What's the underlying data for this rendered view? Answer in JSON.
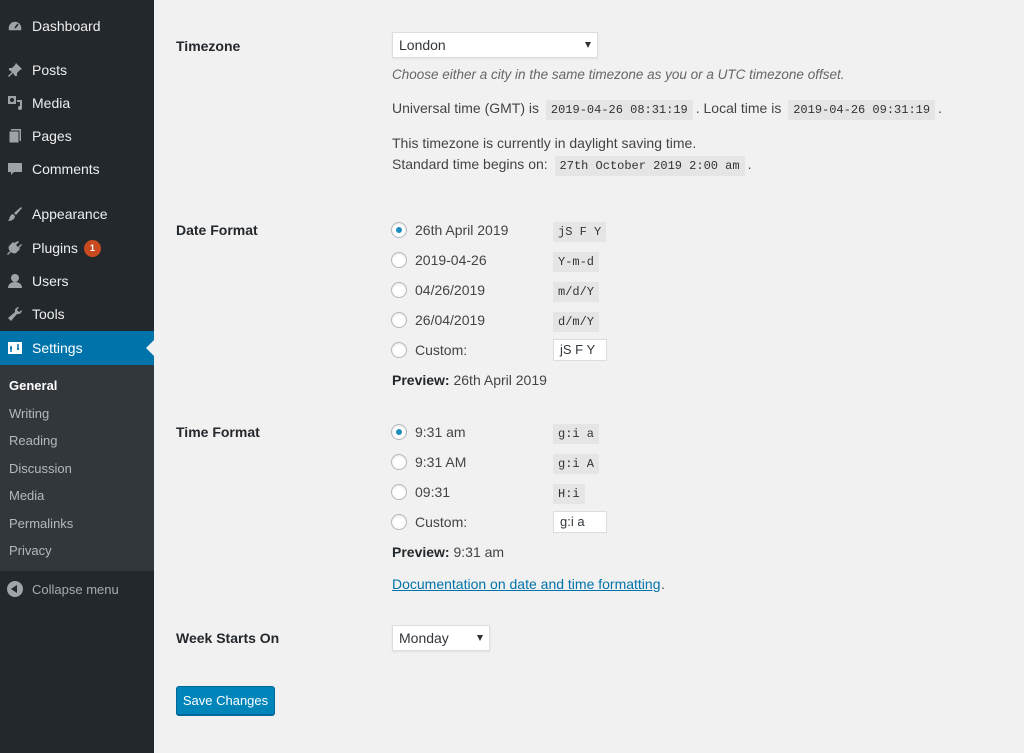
{
  "sidebar": {
    "items": [
      {
        "label": "Dashboard",
        "icon": "dashboard-icon"
      },
      {
        "label": "Posts",
        "icon": "pin-icon"
      },
      {
        "label": "Media",
        "icon": "media-icon"
      },
      {
        "label": "Pages",
        "icon": "pages-icon"
      },
      {
        "label": "Comments",
        "icon": "comment-icon"
      },
      {
        "label": "Appearance",
        "icon": "paintbrush-icon"
      },
      {
        "label": "Plugins",
        "icon": "plugin-icon",
        "badge": "1"
      },
      {
        "label": "Users",
        "icon": "user-icon"
      },
      {
        "label": "Tools",
        "icon": "wrench-icon"
      },
      {
        "label": "Settings",
        "icon": "settings-icon",
        "active": true
      }
    ],
    "submenu": [
      "General",
      "Writing",
      "Reading",
      "Discussion",
      "Media",
      "Permalinks",
      "Privacy"
    ],
    "collapse_label": "Collapse menu"
  },
  "timezone": {
    "label": "Timezone",
    "value": "London",
    "description": "Choose either a city in the same timezone as you or a UTC timezone offset.",
    "utc_prefix": "Universal time (GMT) is",
    "utc_value": "2019-04-26 08:31:19",
    "local_prefix": ". Local time is",
    "local_value": "2019-04-26 09:31:19",
    "local_suffix": ".",
    "dst_note": "This timezone is currently in daylight saving time.",
    "std_prefix": "Standard time begins on:",
    "std_value": "27th October 2019 2:00 am",
    "std_suffix": "."
  },
  "date_format": {
    "label": "Date Format",
    "options": [
      {
        "label": "26th April 2019",
        "format": "jS F Y",
        "checked": true
      },
      {
        "label": "2019-04-26",
        "format": "Y-m-d"
      },
      {
        "label": "04/26/2019",
        "format": "m/d/Y"
      },
      {
        "label": "26/04/2019",
        "format": "d/m/Y"
      }
    ],
    "custom_label": "Custom:",
    "custom_value": "jS F Y",
    "preview_label": "Preview:",
    "preview_value": "26th April 2019"
  },
  "time_format": {
    "label": "Time Format",
    "options": [
      {
        "label": "9:31 am",
        "format": "g:i a",
        "checked": true
      },
      {
        "label": "9:31 AM",
        "format": "g:i A"
      },
      {
        "label": "09:31",
        "format": "H:i"
      }
    ],
    "custom_label": "Custom:",
    "custom_value": "g:i a",
    "preview_label": "Preview:",
    "preview_value": "9:31 am",
    "doc_link": "Documentation on date and time formatting",
    "doc_suffix": "."
  },
  "week_starts": {
    "label": "Week Starts On",
    "value": "Monday"
  },
  "save_label": "Save Changes",
  "colors": {
    "accent": "#0073aa",
    "sidebar_bg": "#23282d",
    "button": "#0085ba",
    "badge": "#ca4a1f"
  }
}
